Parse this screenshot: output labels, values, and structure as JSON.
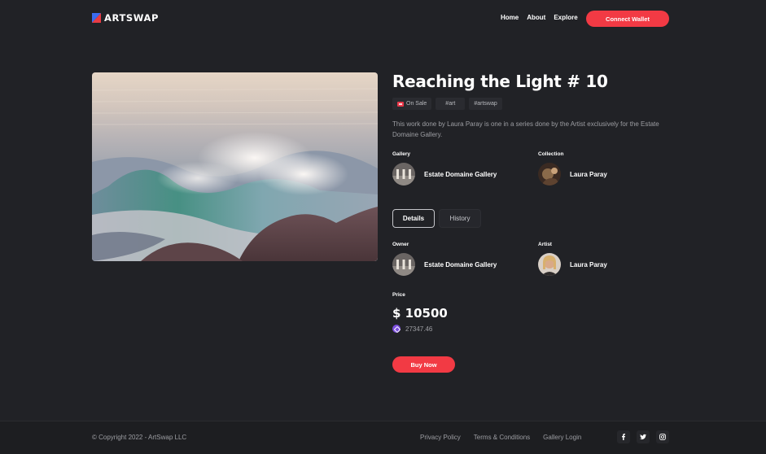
{
  "brand": {
    "name": "ARTSWAP"
  },
  "nav": {
    "items": [
      "Home",
      "About",
      "Explore"
    ],
    "connect_label": "Connect Wallet"
  },
  "artwork": {
    "title": "Reaching the Light # 10",
    "tags": [
      "On Sale",
      "#art",
      "#artswap"
    ],
    "description": "This work done by Laura Paray is one in a series done by the Artist exclusively for the Estate Domaine Gallery."
  },
  "gallery": {
    "label": "Gallery",
    "name": "Estate Domaine Gallery"
  },
  "collection": {
    "label": "Collection",
    "name": "Laura Paray"
  },
  "tabs": {
    "details": "Details",
    "history": "History"
  },
  "owner": {
    "label": "Owner",
    "name": "Estate Domaine Gallery"
  },
  "artist": {
    "label": "Artist",
    "name": "Laura Paray"
  },
  "price": {
    "label": "Price",
    "usd": "$ 10500",
    "crypto": "27347.46"
  },
  "buy_label": "Buy Now",
  "footer": {
    "copyright": "© Copyright 2022 - ArtSwap LLC",
    "links": [
      "Privacy Policy",
      "Terms & Conditions",
      "Gallery Login"
    ],
    "socials": [
      "facebook-icon",
      "twitter-icon",
      "instagram-icon"
    ]
  },
  "colors": {
    "accent": "#f23a44",
    "background": "#212226",
    "footer": "#1d1e21"
  }
}
